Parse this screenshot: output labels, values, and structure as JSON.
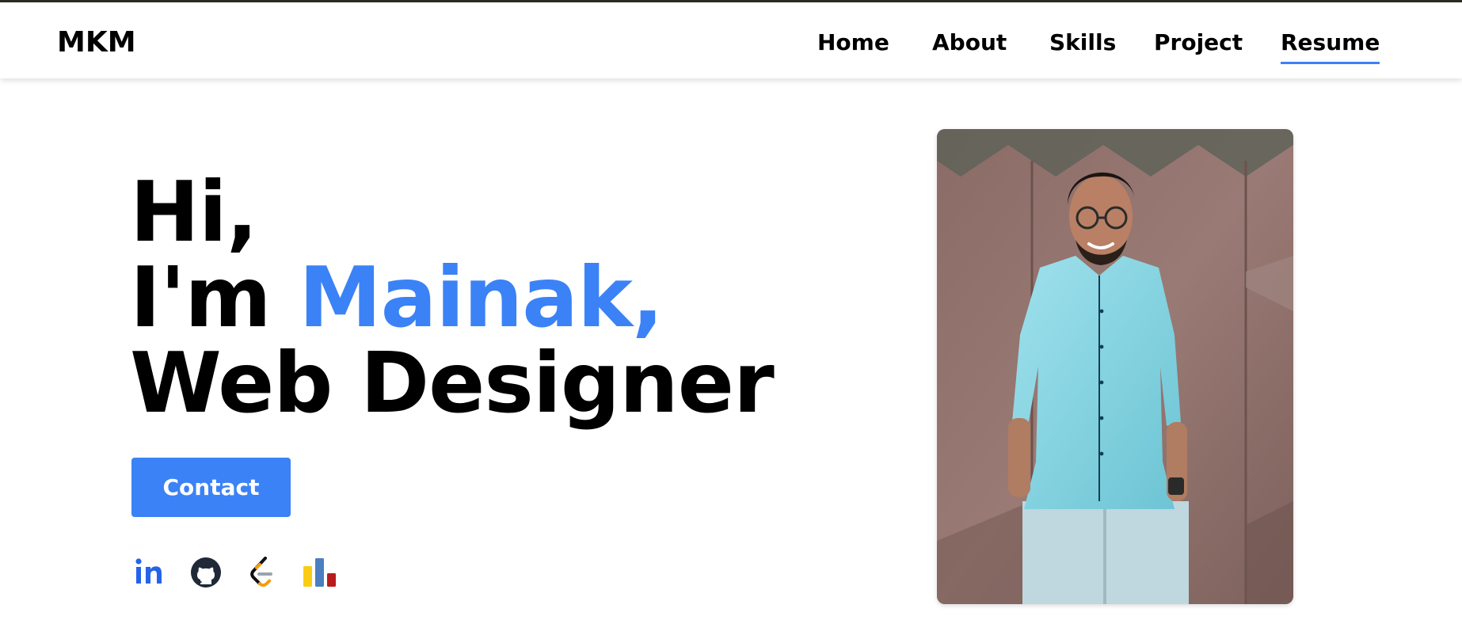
{
  "header": {
    "logo": "MKM",
    "nav": [
      {
        "label": "Home",
        "active": false
      },
      {
        "label": "About",
        "active": false
      },
      {
        "label": "Skills",
        "active": false
      },
      {
        "label": "Project",
        "active": false
      },
      {
        "label": "Resume",
        "active": true
      }
    ]
  },
  "hero": {
    "greeting": "Hi,",
    "intro_prefix": "I'm ",
    "name": "Mainak,",
    "role": "Web Designer",
    "contact_label": "Contact"
  },
  "socials": [
    {
      "icon": "linkedin-icon",
      "color": "#2563eb"
    },
    {
      "icon": "github-icon",
      "color": "#1f2937"
    },
    {
      "icon": "leetcode-icon",
      "color": "#f59e0b"
    },
    {
      "icon": "codechef-stats-icon",
      "color": "#facc15"
    }
  ],
  "colors": {
    "accent": "#3b82f6",
    "text": "#000000",
    "background": "#ffffff"
  }
}
